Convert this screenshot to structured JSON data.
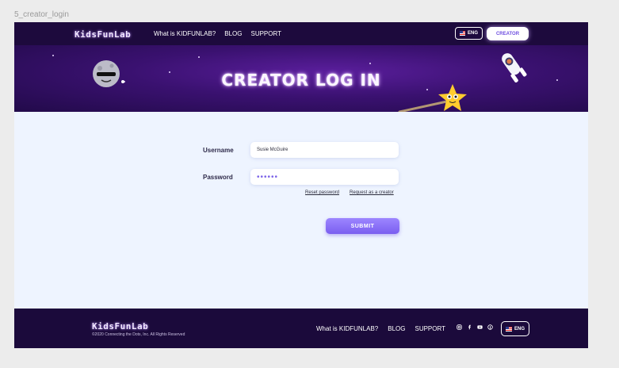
{
  "frame_label": "5_creator_login",
  "nav": {
    "logo": "KidsFunLab",
    "links": [
      "What is KIDFUNLAB?",
      "BLOG",
      "SUPPORT"
    ],
    "lang": "ENG",
    "creator_button": "CREATOR"
  },
  "hero": {
    "title": "CREATOR LOG IN"
  },
  "form": {
    "username_label": "Username",
    "username_value": "Susie McGuire",
    "password_label": "Password",
    "password_value": "••••••",
    "reset_link": "Reset password",
    "request_link": "Request as a creator",
    "submit": "SUBMIT"
  },
  "footer": {
    "logo": "KidsFunLab",
    "copyright": "©2020 Connecting the Dots, Inc. All Rights Reserved",
    "links": [
      "What is KIDFUNLAB?",
      "BLOG",
      "SUPPORT"
    ],
    "social_icons": [
      "instagram-icon",
      "facebook-icon",
      "youtube-icon",
      "pinterest-icon"
    ],
    "lang": "ENG"
  },
  "colors": {
    "nav_bg": "#1d0a3d",
    "hero_bg": "#3a1170",
    "page_bg": "#eef4ff",
    "accent": "#7a5ef0"
  }
}
